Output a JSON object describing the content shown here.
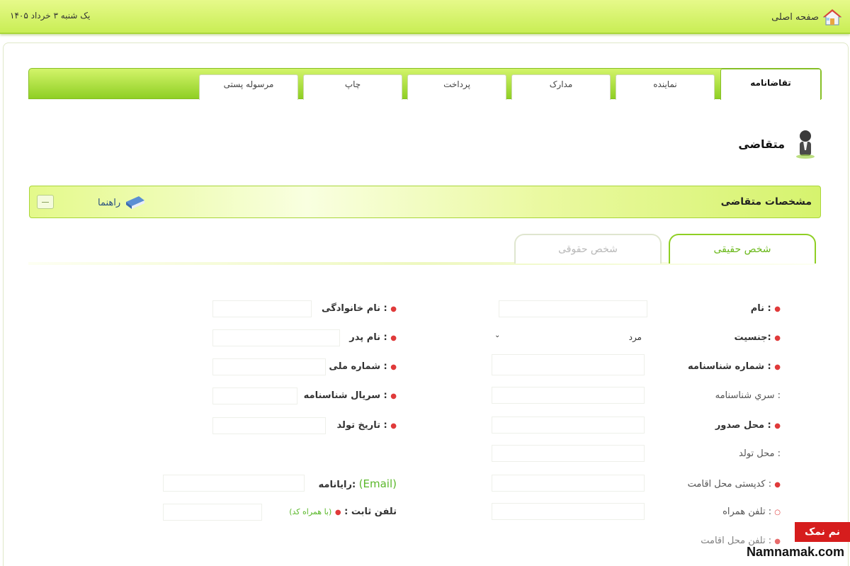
{
  "header": {
    "home_label": "صفحه اصلی",
    "date": "یک شنبه ۳ خرداد ۱۴۰۵"
  },
  "tabs": [
    {
      "label": "تقاضانامه",
      "active": true
    },
    {
      "label": "نماینده",
      "active": false
    },
    {
      "label": "مدارک",
      "active": false
    },
    {
      "label": "پرداخت",
      "active": false
    },
    {
      "label": "چاپ",
      "active": false
    },
    {
      "label": "مرسوله پستی",
      "active": false
    }
  ],
  "person": {
    "title": "متقاضی"
  },
  "section": {
    "title": "مشخصات متقاضی",
    "help_label": "راهنما"
  },
  "subtabs": [
    {
      "label": "شخص حقیقی",
      "active": true
    },
    {
      "label": "شخص حقوقی",
      "active": false
    }
  ],
  "form": {
    "first_name": {
      "label": "نام :",
      "required": "●"
    },
    "last_name": {
      "label": "نام خانوادگی :",
      "required": "●"
    },
    "gender": {
      "label": "جنسیت:",
      "required": "●",
      "value": "مرد",
      "arrow": "⌄"
    },
    "father_name": {
      "label": "نام پدر :",
      "required": "●"
    },
    "id_number": {
      "label": "شماره شناسنامه :",
      "required": "●"
    },
    "national_code": {
      "label": "شماره ملی :",
      "required": "●"
    },
    "id_series": {
      "label": "سري شناسنامه :"
    },
    "id_serial": {
      "label": "سریال شناسنامه :",
      "required": "●"
    },
    "issue_place": {
      "label": "محل صدور :",
      "required": "●"
    },
    "birth_date": {
      "label": "تاریخ تولد :",
      "required": "●"
    },
    "birth_place": {
      "label": "محل تولد :"
    },
    "postal_code": {
      "label": "کدپستی محل اقامت :",
      "required": "●"
    },
    "email": {
      "label": "رایانامه:",
      "hint": "(Email)"
    },
    "mobile": {
      "label": "تلفن همراه :",
      "required": "○"
    },
    "landline": {
      "label": "تلفن ثابت :",
      "required": "●",
      "hint": "(با همراه کد)"
    },
    "extra": {
      "label": "تلفن محل اقامت :",
      "required": "●"
    }
  },
  "watermark": {
    "badge": "نم نمک",
    "site": "Namnamak.com"
  },
  "colors": {
    "header_green": "#d8f46e",
    "tab_green": "#8fcf24",
    "active_subtab": "#6ab81a",
    "required": "#e03a3a",
    "hint": "#5ab82a"
  }
}
